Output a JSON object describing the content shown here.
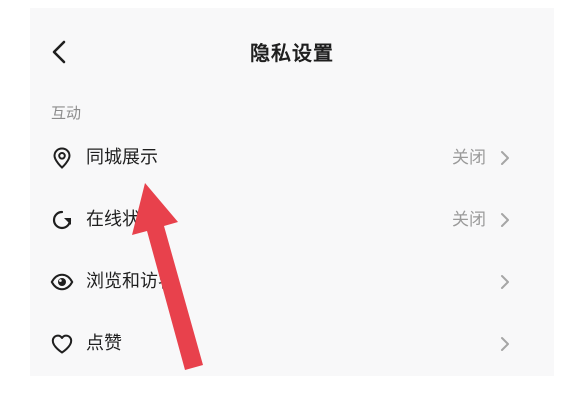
{
  "header": {
    "title": "隐私设置",
    "back_icon": "chevron-left-icon"
  },
  "section": {
    "title": "互动"
  },
  "rows": [
    {
      "label": "同城展示",
      "value": "关闭",
      "icon": "location-pin-icon"
    },
    {
      "label": "在线状态",
      "value": "关闭",
      "icon": "online-status-icon"
    },
    {
      "label": "浏览和访客",
      "value": "",
      "icon": "eye-icon"
    },
    {
      "label": "点赞",
      "value": "",
      "icon": "heart-icon"
    }
  ],
  "colors": {
    "screen_background": "#f8f8f9",
    "text_primary": "#1f1f1f",
    "text_secondary": "#9a9a9a",
    "annotation_arrow": "#e8414c"
  }
}
